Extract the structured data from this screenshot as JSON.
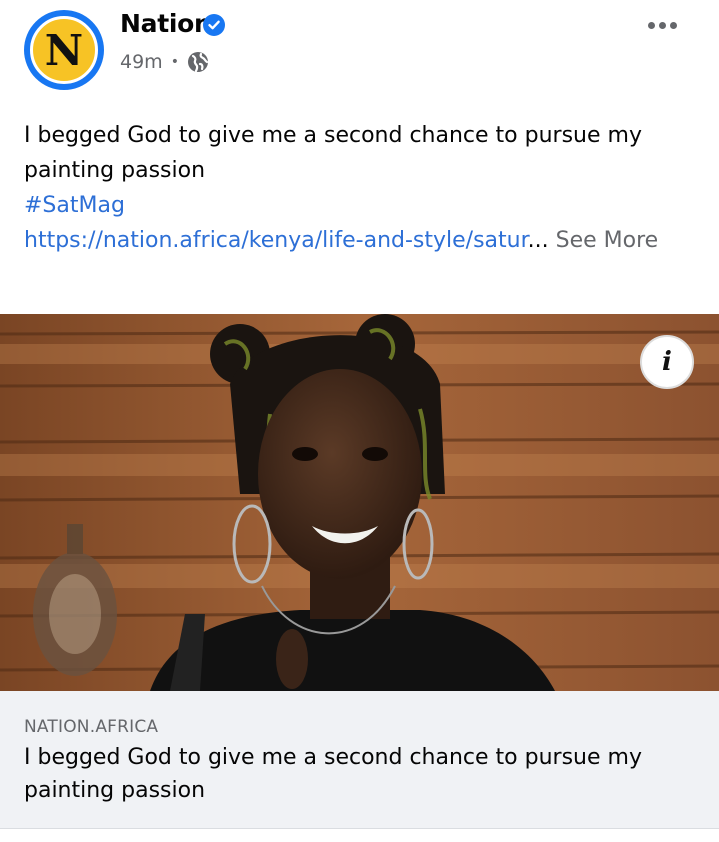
{
  "header": {
    "page_name": "Nation",
    "avatar_letter": "N",
    "timestamp": "49m",
    "separator": "•",
    "audience_icon": "globe-icon",
    "verified_icon": "verified-badge-icon",
    "more_icon": "more-options-icon"
  },
  "post": {
    "text": "I begged God to give me a second chance to pursue my painting passion",
    "hashtag": "#SatMag",
    "url": "https://nation.africa/kenya/life-and-style/satur",
    "ellipsis": "...",
    "see_more": "See More"
  },
  "media": {
    "info_label": "i"
  },
  "link_card": {
    "domain": "NATION.AFRICA",
    "title": "I begged God to give me a second chance to pursue my painting passion"
  },
  "colors": {
    "brand_blue": "#1877f2",
    "avatar_yellow": "#f7c325",
    "link_blue": "#2d6fd6",
    "muted_gray": "#65676b",
    "card_bg": "#f0f2f5"
  }
}
